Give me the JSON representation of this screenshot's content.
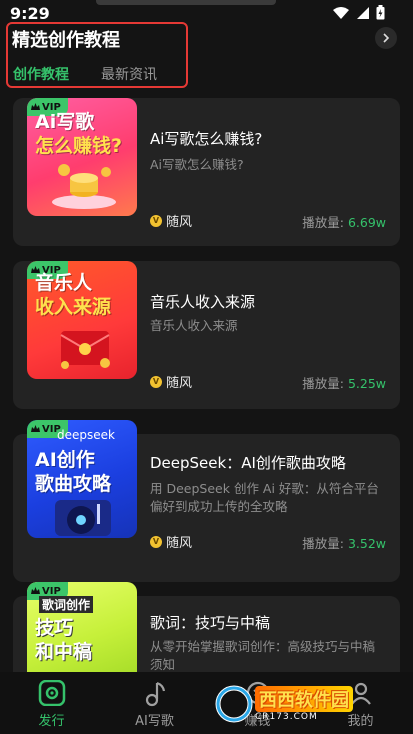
{
  "status_bar": {
    "time": "9:29"
  },
  "header": {
    "title": "精选创作教程"
  },
  "tabs": [
    {
      "label": "创作教程",
      "active": true
    },
    {
      "label": "最新资讯",
      "active": false
    }
  ],
  "cards": [
    {
      "title": "Ai写歌怎么赚钱?",
      "subtitle": "Ai写歌怎么赚钱?",
      "author": "随风",
      "plays_label": "播放量: ",
      "plays_value": "6.69w",
      "thumb_lines": [
        "Ai写歌",
        "怎么赚钱?"
      ],
      "vip": "VIP"
    },
    {
      "title": "音乐人收入来源",
      "subtitle": "音乐人收入来源",
      "author": "随风",
      "plays_label": "播放量: ",
      "plays_value": "5.25w",
      "thumb_lines": [
        "音乐人",
        "收入来源"
      ],
      "vip": "VIP"
    },
    {
      "title": "DeepSeek：AI创作歌曲攻略",
      "subtitle": "用 DeepSeek 创作 Ai 好歌：从符合平台偏好到成功上传的全攻略",
      "author": "随风",
      "plays_label": "播放量: ",
      "plays_value": "3.52w",
      "thumb_lines": [
        "deepseek",
        "AI创作",
        "歌曲攻略"
      ],
      "vip": "VIP"
    },
    {
      "title": "歌词：技巧与中稿",
      "subtitle": "从零开始掌握歌词创作：高级技巧与中稿须知",
      "thumb_lines": [
        "歌词创作",
        "技巧",
        "和中稿"
      ],
      "vip": "VIP"
    }
  ],
  "bottom_nav": [
    {
      "label": "发行",
      "icon": "release-icon",
      "active": true
    },
    {
      "label": "AI写歌",
      "icon": "music-note-icon",
      "active": false
    },
    {
      "label": "赚钱",
      "icon": "money-icon",
      "active": false
    },
    {
      "label": "我的",
      "icon": "profile-icon",
      "active": false
    }
  ],
  "watermark": {
    "text": "西西软件园",
    "domain": "CR173.COM"
  },
  "colors": {
    "accent": "#35c26b",
    "highlight_border": "#e53935",
    "card_bg": "#232323",
    "page_bg": "#141414"
  }
}
